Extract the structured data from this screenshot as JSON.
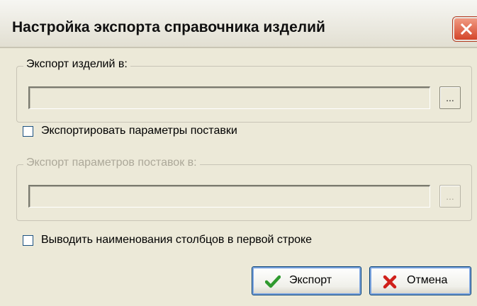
{
  "window": {
    "title": "Настройка экспорта справочника изделий",
    "close_icon": "close-icon"
  },
  "export_items": {
    "legend": "Экспорт изделий в:",
    "path_value": "",
    "browse_label": "...",
    "enabled": true
  },
  "export_supply_params_checkbox": {
    "label": "Экспортировать параметры поставки",
    "checked": false
  },
  "export_supply": {
    "legend": "Экспорт параметров поставок в:",
    "path_value": "",
    "browse_label": "...",
    "enabled": false
  },
  "column_names_checkbox": {
    "label": "Выводить наименования столбцов в первой строке",
    "checked": false
  },
  "buttons": {
    "export_label": "Экспорт",
    "export_icon": "checkmark-icon",
    "cancel_label": "Отмена",
    "cancel_icon": "x-icon"
  },
  "colors": {
    "dialog_bg": "#ece9d8",
    "disabled_text": "#aca899",
    "checkmark_green": "#2f9a2f",
    "cancel_red": "#d0201a",
    "close_red": "#d4452a"
  }
}
